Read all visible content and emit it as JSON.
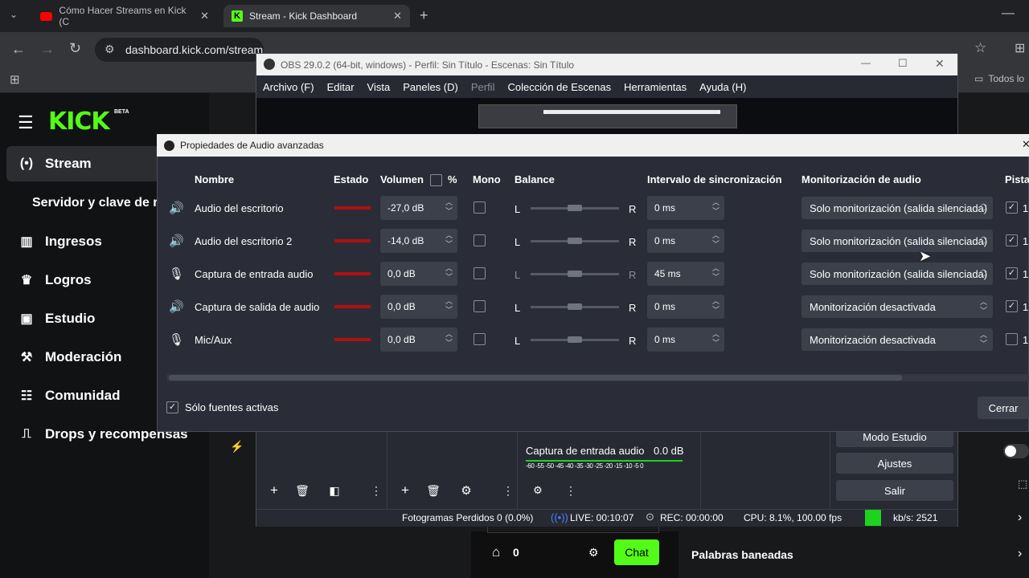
{
  "browser": {
    "tabs": [
      {
        "title": "Cómo Hacer Streams en Kick (C"
      },
      {
        "title": "Stream - Kick Dashboard"
      }
    ],
    "url": "dashboard.kick.com/stream",
    "bookmark_folder": "Todos lo"
  },
  "kick": {
    "logo": "KICK",
    "beta": "BETA",
    "nav": [
      {
        "label": "Stream",
        "icon": "broadcast-icon"
      },
      {
        "label": "Servidor y clave de r",
        "icon": ""
      },
      {
        "label": "Ingresos",
        "icon": "chart-icon"
      },
      {
        "label": "Logros",
        "icon": "trophy-icon"
      },
      {
        "label": "Estudio",
        "icon": "film-icon"
      },
      {
        "label": "Moderación",
        "icon": "wrench-icon"
      },
      {
        "label": "Comunidad",
        "icon": "people-icon"
      },
      {
        "label": "Drops y recompensas",
        "icon": "gift-icon"
      }
    ],
    "chat_count": "0",
    "chat_button": "Chat",
    "banned_words": "Palabras baneadas"
  },
  "obs": {
    "title": "OBS 29.0.2 (64-bit, windows) - Perfil: Sin Título - Escenas: Sin Título",
    "menu": [
      "Archivo (F)",
      "Editar",
      "Vista",
      "Paneles (D)",
      "Perfil",
      "Colección de Escenas",
      "Herramientas",
      "Ayuda (H)"
    ],
    "mixer_label": "Captura de entrada audio",
    "mixer_value": "0.0 dB",
    "mixer_scale": "-60 -55 -50 -45 -40 -35 -30 -25 -20 -15 -10 -5 0",
    "controls": [
      "Modo Estudio",
      "Ajustes",
      "Salir"
    ],
    "status": {
      "dropped": "Fotogramas Perdidos 0 (0.0%)",
      "live": "LIVE: 00:10:07",
      "rec": "REC: 00:00:00",
      "cpu": "CPU: 8.1%, 100.00 fps",
      "kbs": "kb/s: 2521"
    }
  },
  "dialog": {
    "title": "Propiedades de Audio avanzadas",
    "headers": {
      "name": "Nombre",
      "state": "Estado",
      "volume": "Volumen",
      "percent": "%",
      "mono": "Mono",
      "balance": "Balance",
      "sync": "Intervalo de sincronización",
      "monitor": "Monitorización de audio",
      "tracks": "Pista"
    },
    "rows": [
      {
        "name": "Audio del escritorio",
        "volume": "-27,0 dB",
        "mono": false,
        "left": "L",
        "right": "R",
        "sync": "0 ms",
        "monitor": "Solo monitorización (salida silenciada)",
        "track": true,
        "track_label": "1",
        "icon": "speaker-icon"
      },
      {
        "name": "Audio del escritorio 2",
        "volume": "-14,0 dB",
        "mono": false,
        "left": "L",
        "right": "R",
        "sync": "0 ms",
        "monitor": "Solo monitorización (salida silenciada)",
        "track": true,
        "track_label": "1",
        "icon": "speaker-icon"
      },
      {
        "name": "Captura de entrada audio",
        "volume": "0,0 dB",
        "mono": false,
        "left": "L",
        "right": "R",
        "sync": "45 ms",
        "monitor": "Solo monitorización (salida silenciada)",
        "track": true,
        "track_label": "1",
        "icon": "microphone-icon"
      },
      {
        "name": "Captura de salida de audio",
        "volume": "0,0 dB",
        "mono": false,
        "left": "L",
        "right": "R",
        "sync": "0 ms",
        "monitor": "Monitorización desactivada",
        "track": true,
        "track_label": "1",
        "icon": "speaker-icon"
      },
      {
        "name": "Mic/Aux",
        "volume": "0,0 dB",
        "mono": false,
        "left": "L",
        "right": "R",
        "sync": "0 ms",
        "monitor": "Monitorización desactivada",
        "track": false,
        "track_label": "1",
        "icon": "microphone-icon"
      }
    ],
    "only_active": "Sólo fuentes activas",
    "close": "Cerrar"
  },
  "colors": {
    "kick_green": "#53fc18",
    "vu_red": "#b01010",
    "live_green": "#1ed31e"
  }
}
